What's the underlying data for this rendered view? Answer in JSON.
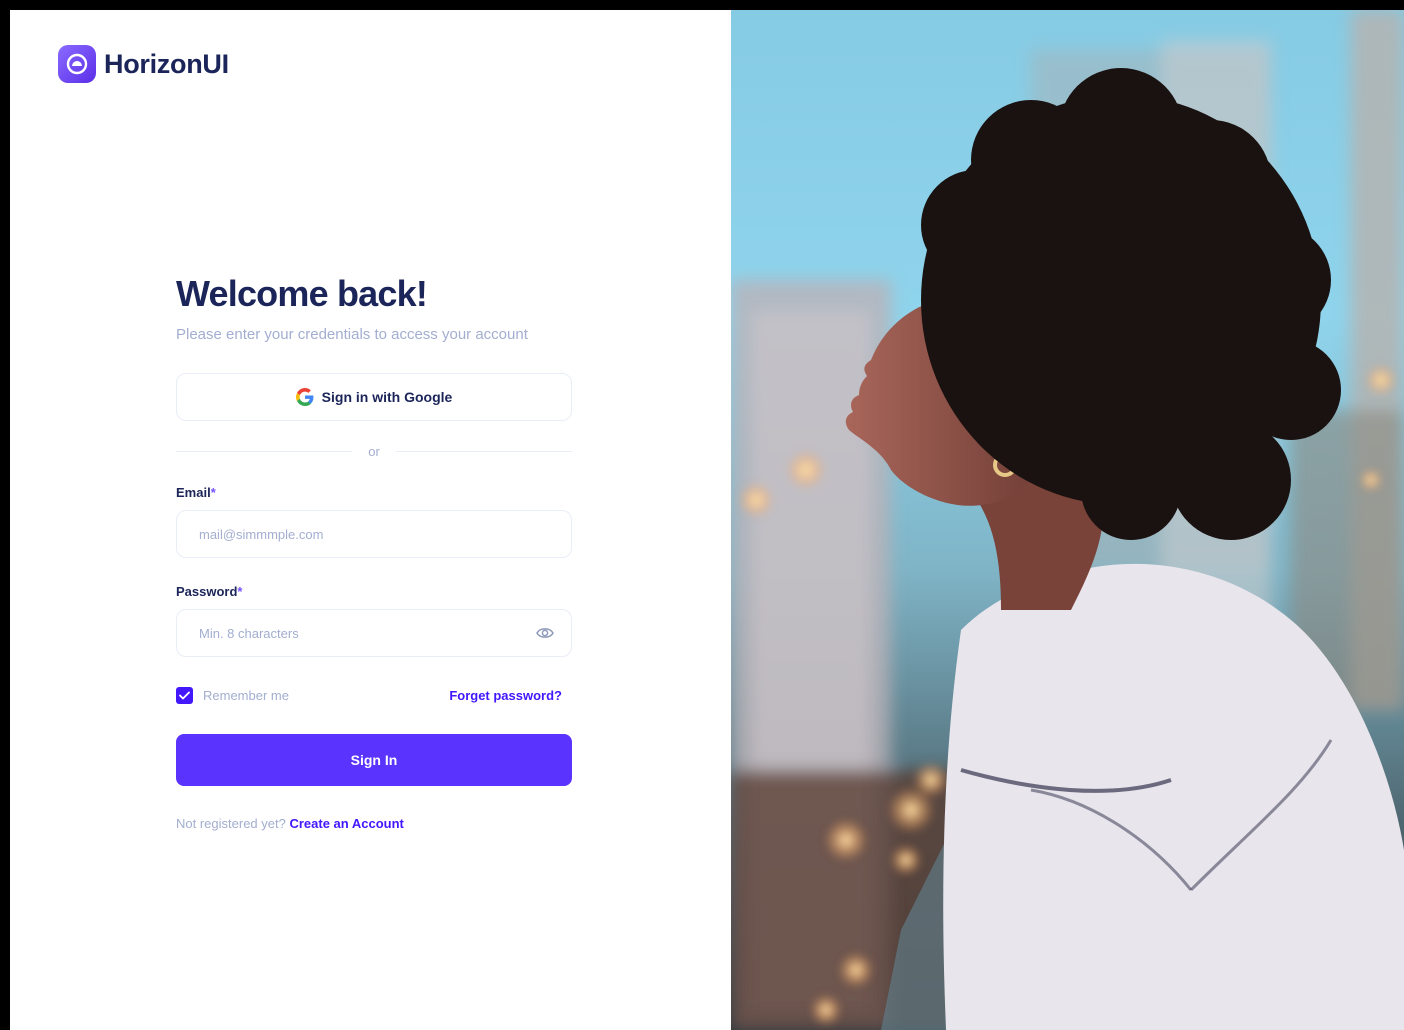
{
  "brand": {
    "name": "HorizonUI"
  },
  "login": {
    "title": "Welcome back!",
    "subtitle": "Please enter your credentials to access your account",
    "google_button": "Sign in with Google",
    "divider": "or",
    "email_label": "Email",
    "email_required": "*",
    "email_placeholder": "mail@simmmple.com",
    "password_label": "Password",
    "password_required": "*",
    "password_placeholder": "Min. 8 characters",
    "remember_label": "Remember me",
    "remember_checked": true,
    "forgot_link": "Forget password?",
    "signin_button": "Sign In",
    "register_prompt": "Not registered yet?",
    "register_link": "Create an Account"
  },
  "icons": {
    "logo": "horizon-logo-icon",
    "google": "google-icon",
    "eye": "eye-icon",
    "check": "check-icon"
  },
  "colors": {
    "primary": "#4318ff",
    "button": "#5a33ff",
    "heading": "#1b2559",
    "muted": "#a3aed0",
    "border": "#e9edf7"
  }
}
